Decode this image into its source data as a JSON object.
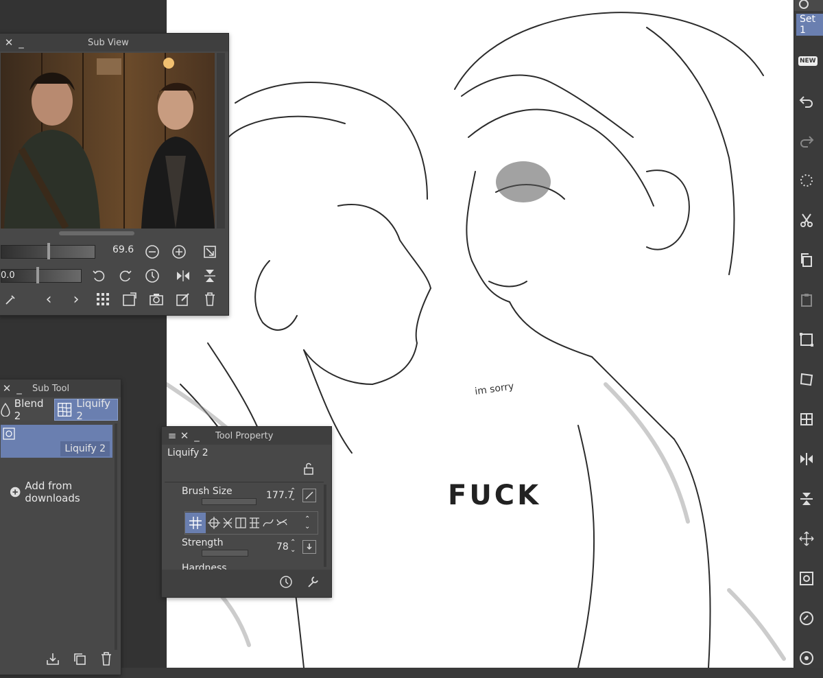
{
  "subview": {
    "title": "Sub View",
    "zoom_value": "69.6",
    "rotation_value": "0.0"
  },
  "subtool": {
    "title": "Sub Tool",
    "tabs": [
      "Blend 2",
      "Liquify 2"
    ],
    "selected_item": "Liquify 2",
    "add_from_downloads": "Add from downloads"
  },
  "toolprop": {
    "title": "Tool Property",
    "preset_name": "Liquify 2",
    "brush_size_label": "Brush Size",
    "brush_size_value": "177.7",
    "strength_label": "Strength",
    "strength_value": "78",
    "hardness_label": "Hardness"
  },
  "rightbar": {
    "set_label": "Set 1",
    "new_badge": "NEW"
  },
  "canvas": {
    "handwritten_1": "im sorry",
    "handwritten_2": "FUCK"
  },
  "colors": {
    "accent": "#6a7fb0",
    "panel": "#484848",
    "titlebar": "#3f3f3f"
  }
}
